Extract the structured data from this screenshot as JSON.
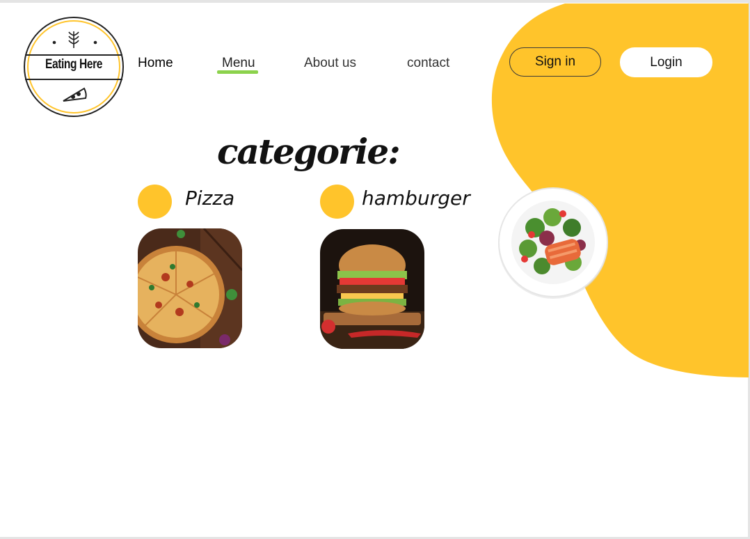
{
  "brand": {
    "name": "Eating Here"
  },
  "nav": {
    "items": [
      {
        "label": "Home"
      },
      {
        "label": "Menu"
      },
      {
        "label": "About us"
      },
      {
        "label": "contact"
      }
    ],
    "active": "Menu"
  },
  "auth": {
    "signin_label": "Sign in",
    "login_label": "Login"
  },
  "categories": {
    "title": "categorie:",
    "items": [
      {
        "label": "Pizza",
        "image": "pizza-photo"
      },
      {
        "label": "hamburger",
        "image": "hamburger-photo"
      }
    ]
  },
  "colors": {
    "accent": "#ffc42b",
    "active_underline": "#8cd24c",
    "background": "#ffffff"
  },
  "hero": {
    "image": "salmon-salad-plate"
  }
}
